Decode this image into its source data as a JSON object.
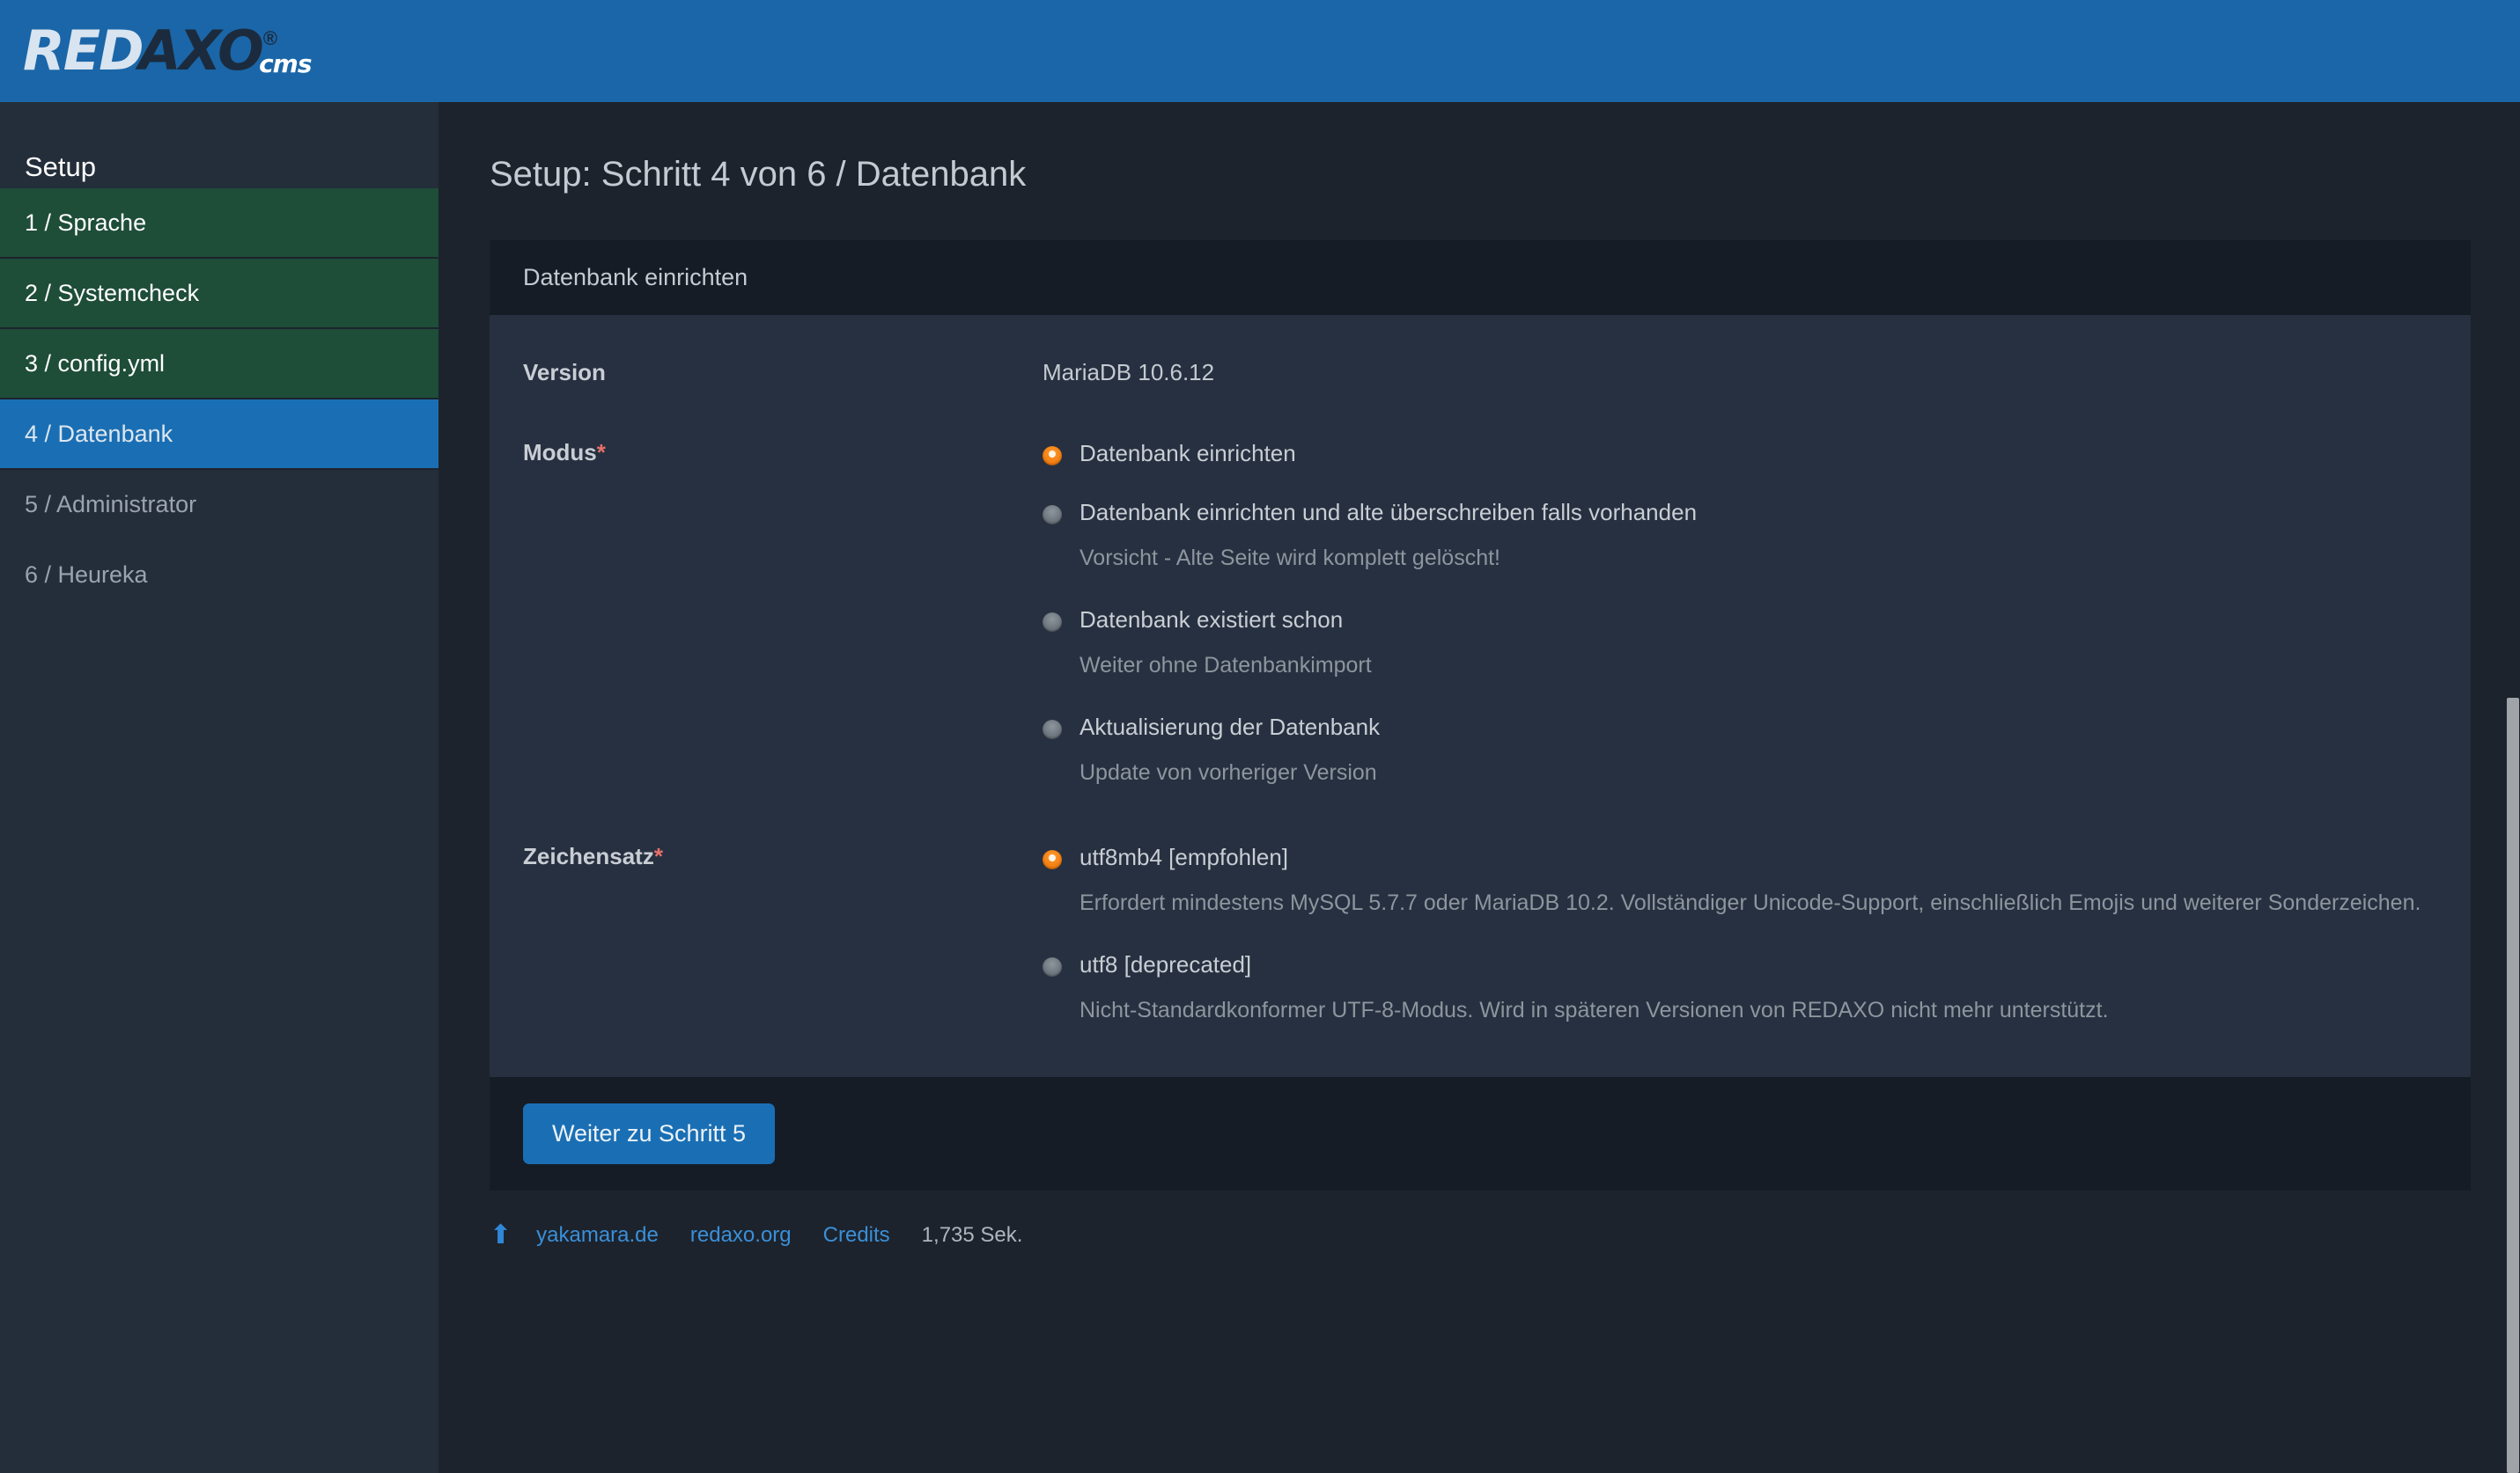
{
  "brand": {
    "logo_red": "RED",
    "logo_axo": "AXO",
    "logo_registered": "®",
    "logo_cms": "cms",
    "topbar_color": "#1a66a8"
  },
  "sidebar": {
    "title": "Setup",
    "items": [
      {
        "label": "1 / Sprache",
        "state": "done"
      },
      {
        "label": "2 / Systemcheck",
        "state": "done"
      },
      {
        "label": "3 / config.yml",
        "state": "done"
      },
      {
        "label": "4 / Datenbank",
        "state": "active"
      },
      {
        "label": "5 / Administrator",
        "state": "todo"
      },
      {
        "label": "6 / Heureka",
        "state": "todo"
      }
    ],
    "colors": {
      "done": "#1e4d38",
      "active": "#1a6fb4",
      "background": "#242e3a"
    }
  },
  "main": {
    "page_title": "Setup: Schritt 4 von 6 / Datenbank",
    "panel_title": "Datenbank einrichten",
    "rows": {
      "version": {
        "label": "Version",
        "value": "MariaDB 10.6.12"
      },
      "modus": {
        "label": "Modus",
        "required_mark": "*",
        "options": [
          {
            "label": "Datenbank einrichten",
            "selected": true,
            "help": ""
          },
          {
            "label": "Datenbank einrichten und alte überschreiben falls vorhanden",
            "selected": false,
            "help": "Vorsicht - Alte Seite wird komplett gelöscht!"
          },
          {
            "label": "Datenbank existiert schon",
            "selected": false,
            "help": "Weiter ohne Datenbankimport"
          },
          {
            "label": "Aktualisierung der Datenbank",
            "selected": false,
            "help": "Update von vorheriger Version"
          }
        ]
      },
      "zeichensatz": {
        "label": "Zeichensatz",
        "required_mark": "*",
        "options": [
          {
            "label": "utf8mb4 [empfohlen]",
            "selected": true,
            "help": "Erfordert mindestens MySQL 5.7.7 oder MariaDB 10.2. Vollständiger Unicode-Support, einschließlich Emojis und weiterer Sonderzeichen."
          },
          {
            "label": "utf8 [deprecated]",
            "selected": false,
            "help": "Nicht-Standardkonformer UTF-8-Modus. Wird in späteren Versionen von REDAXO nicht mehr unterstützt."
          }
        ]
      }
    },
    "submit_label": "Weiter zu Schritt 5"
  },
  "footer": {
    "scroll_top_icon": "arrow-up-icon",
    "links": [
      {
        "label": "yakamara.de"
      },
      {
        "label": "redaxo.org"
      },
      {
        "label": "Credits"
      }
    ],
    "time": "1,735 Sek."
  },
  "accents": {
    "radio_selected": "#f07c10",
    "required": "#e8706a",
    "link": "#3a8fd9",
    "button": "#1a6fb4"
  }
}
